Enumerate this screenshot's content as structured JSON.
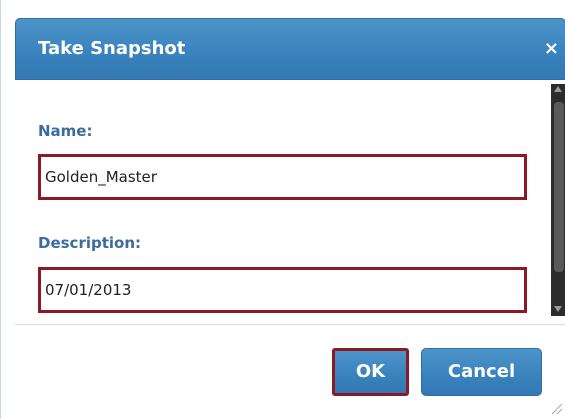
{
  "dialog": {
    "title": "Take Snapshot",
    "close_symbol": "×"
  },
  "form": {
    "name_label": "Name:",
    "name_value": "Golden_Master",
    "description_label": "Description:",
    "description_value": "07/01/2013"
  },
  "buttons": {
    "ok_label": "OK",
    "cancel_label": "Cancel"
  },
  "icons": {
    "close": "close-icon",
    "resize": "resize-grip-icon"
  },
  "colors": {
    "titlebar": "#3a83be",
    "label": "#3a6d9e",
    "highlight_border": "#8a1a24"
  }
}
